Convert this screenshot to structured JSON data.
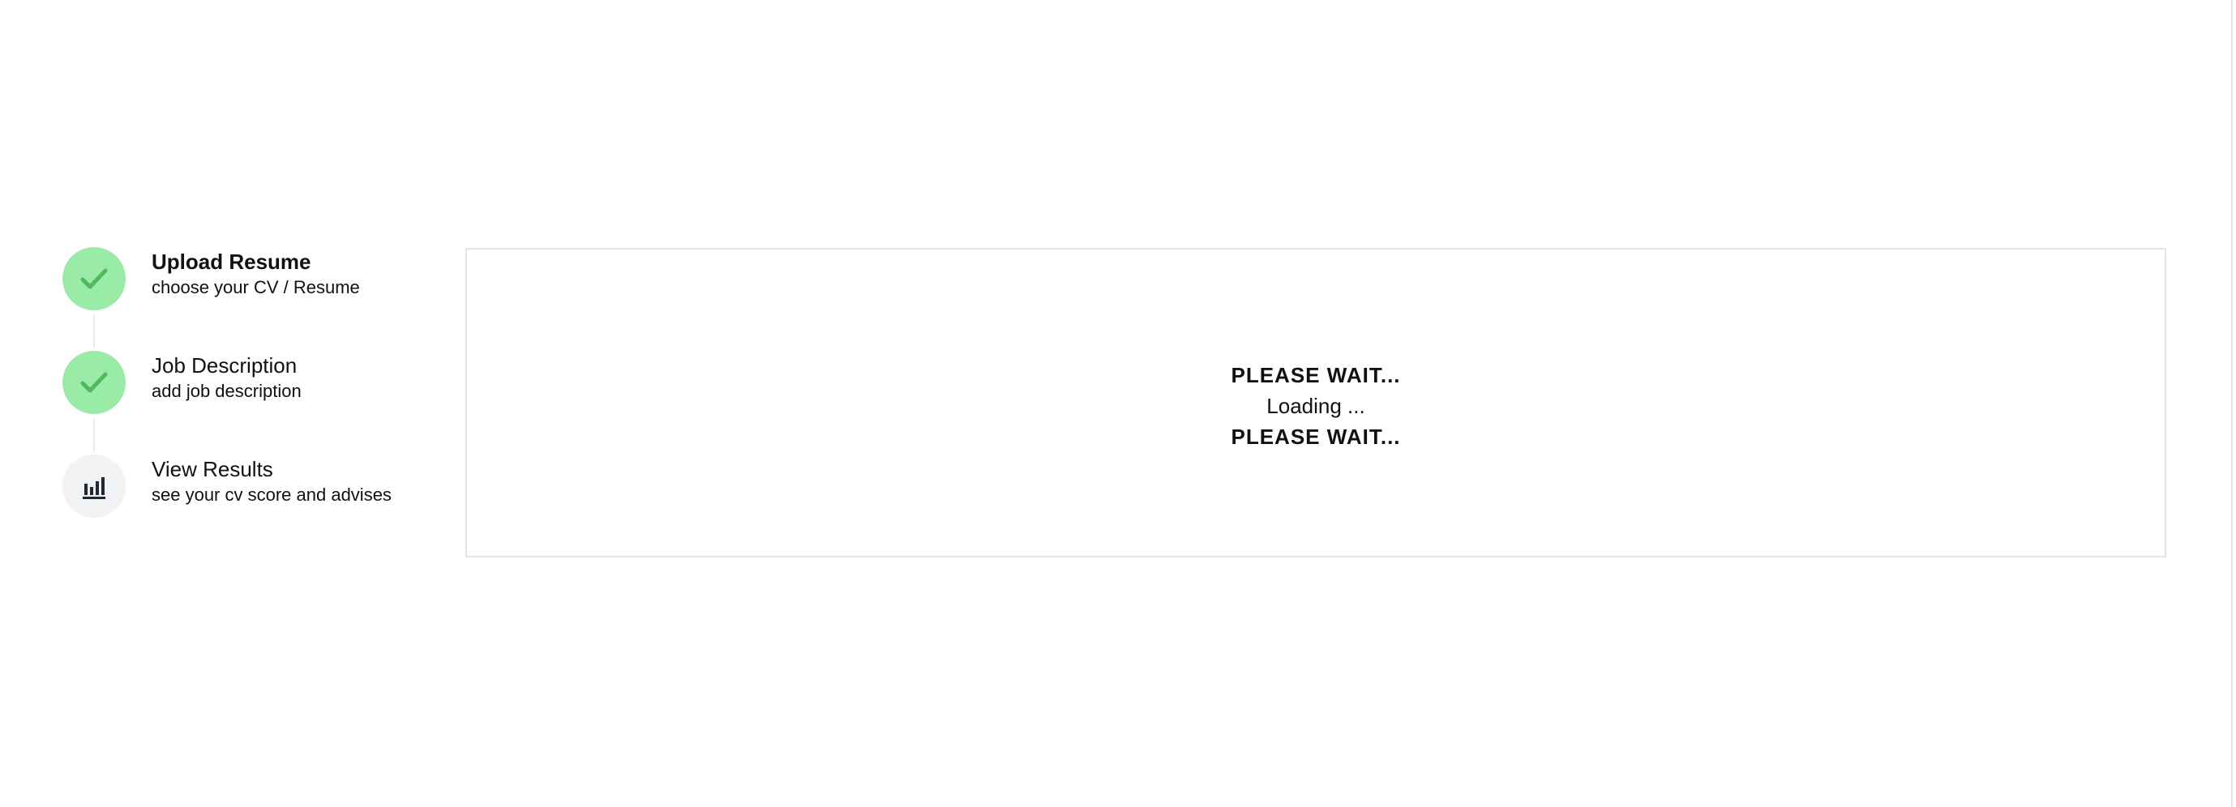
{
  "steps": [
    {
      "title": "Upload Resume",
      "subtitle": "choose your CV / Resume",
      "status": "completed",
      "icon": "check-icon"
    },
    {
      "title": "Job Description",
      "subtitle": "add job description",
      "status": "completed",
      "icon": "check-icon"
    },
    {
      "title": "View Results",
      "subtitle": "see your cv score and advises",
      "status": "current",
      "icon": "bar-chart-icon"
    }
  ],
  "loading": {
    "heading_top": "PLEASE WAIT...",
    "message": "Loading ...",
    "heading_bottom": "PLEASE WAIT..."
  },
  "colors": {
    "completed_circle": "#9aeba7",
    "check": "#4cbb5e",
    "pending_circle": "#f1f2f4",
    "panel_border": "#e5e5e5",
    "text": "#111111"
  }
}
